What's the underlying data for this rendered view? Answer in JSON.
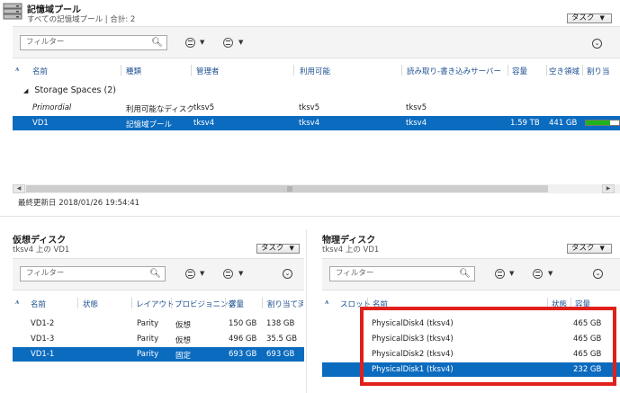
{
  "storage_pool": {
    "title": "記憶域プール",
    "subtitle": "すべての記憶域プール | 合計: 2",
    "task_label": "タスク",
    "filter_placeholder": "フィルター",
    "columns": [
      "名前",
      "種類",
      "管理者",
      "利用可能",
      "読み取り-書き込みサーバー",
      "容量",
      "空き領域",
      "割り当"
    ],
    "group_label": "Storage Spaces (2)",
    "rows": [
      {
        "name": "Primordial",
        "type": "利用可能なディスク",
        "manager": "tksv5",
        "available": "tksv5",
        "rw_server": "tksv5",
        "capacity": "",
        "free": "",
        "selected": false,
        "italic": true
      },
      {
        "name": "VD1",
        "type": "記憶域プール",
        "manager": "tksv4",
        "available": "tksv4",
        "rw_server": "tksv4",
        "capacity": "1.59 TB",
        "free": "441 GB",
        "selected": true,
        "italic": false,
        "allocated_fraction": 0.72
      }
    ],
    "footer": "最終更新日 2018/01/26 19:54:41"
  },
  "virtual_disk": {
    "title": "仮想ディスク",
    "subtitle": "tksv4 上の VD1",
    "task_label": "タスク",
    "filter_placeholder": "フィルター",
    "columns": [
      "名前",
      "状態",
      "レイアウト",
      "プロビジョニング",
      "容量",
      "割り当て済"
    ],
    "rows": [
      {
        "name": "VD1-2",
        "status": "",
        "layout": "Parity",
        "provisioning": "仮想",
        "capacity": "150 GB",
        "allocated": "138 GB",
        "selected": false
      },
      {
        "name": "VD1-3",
        "status": "",
        "layout": "Parity",
        "provisioning": "仮想",
        "capacity": "496 GB",
        "allocated": "35.5 GB",
        "selected": false
      },
      {
        "name": "VD1-1",
        "status": "",
        "layout": "Parity",
        "provisioning": "固定",
        "capacity": "693 GB",
        "allocated": "693 GB",
        "selected": true
      }
    ]
  },
  "physical_disk": {
    "title": "物理ディスク",
    "subtitle": "tksv4 上の VD1",
    "task_label": "タスク",
    "filter_placeholder": "フィルター",
    "columns": [
      "スロット",
      "名前",
      "状態",
      "容量"
    ],
    "rows": [
      {
        "slot": "",
        "name": "PhysicalDisk4 (tksv4)",
        "status": "",
        "capacity": "465 GB",
        "selected": false
      },
      {
        "slot": "",
        "name": "PhysicalDisk3 (tksv4)",
        "status": "",
        "capacity": "465 GB",
        "selected": false
      },
      {
        "slot": "",
        "name": "PhysicalDisk2 (tksv4)",
        "status": "",
        "capacity": "465 GB",
        "selected": false
      },
      {
        "slot": "",
        "name": "PhysicalDisk1 (tksv4)",
        "status": "",
        "capacity": "232 GB",
        "selected": true
      }
    ],
    "highlight_color": "#e0201a"
  },
  "colors": {
    "selection": "#0b6bbf",
    "header_text": "#1c4f91",
    "bar_fill": "#1fb31f"
  }
}
